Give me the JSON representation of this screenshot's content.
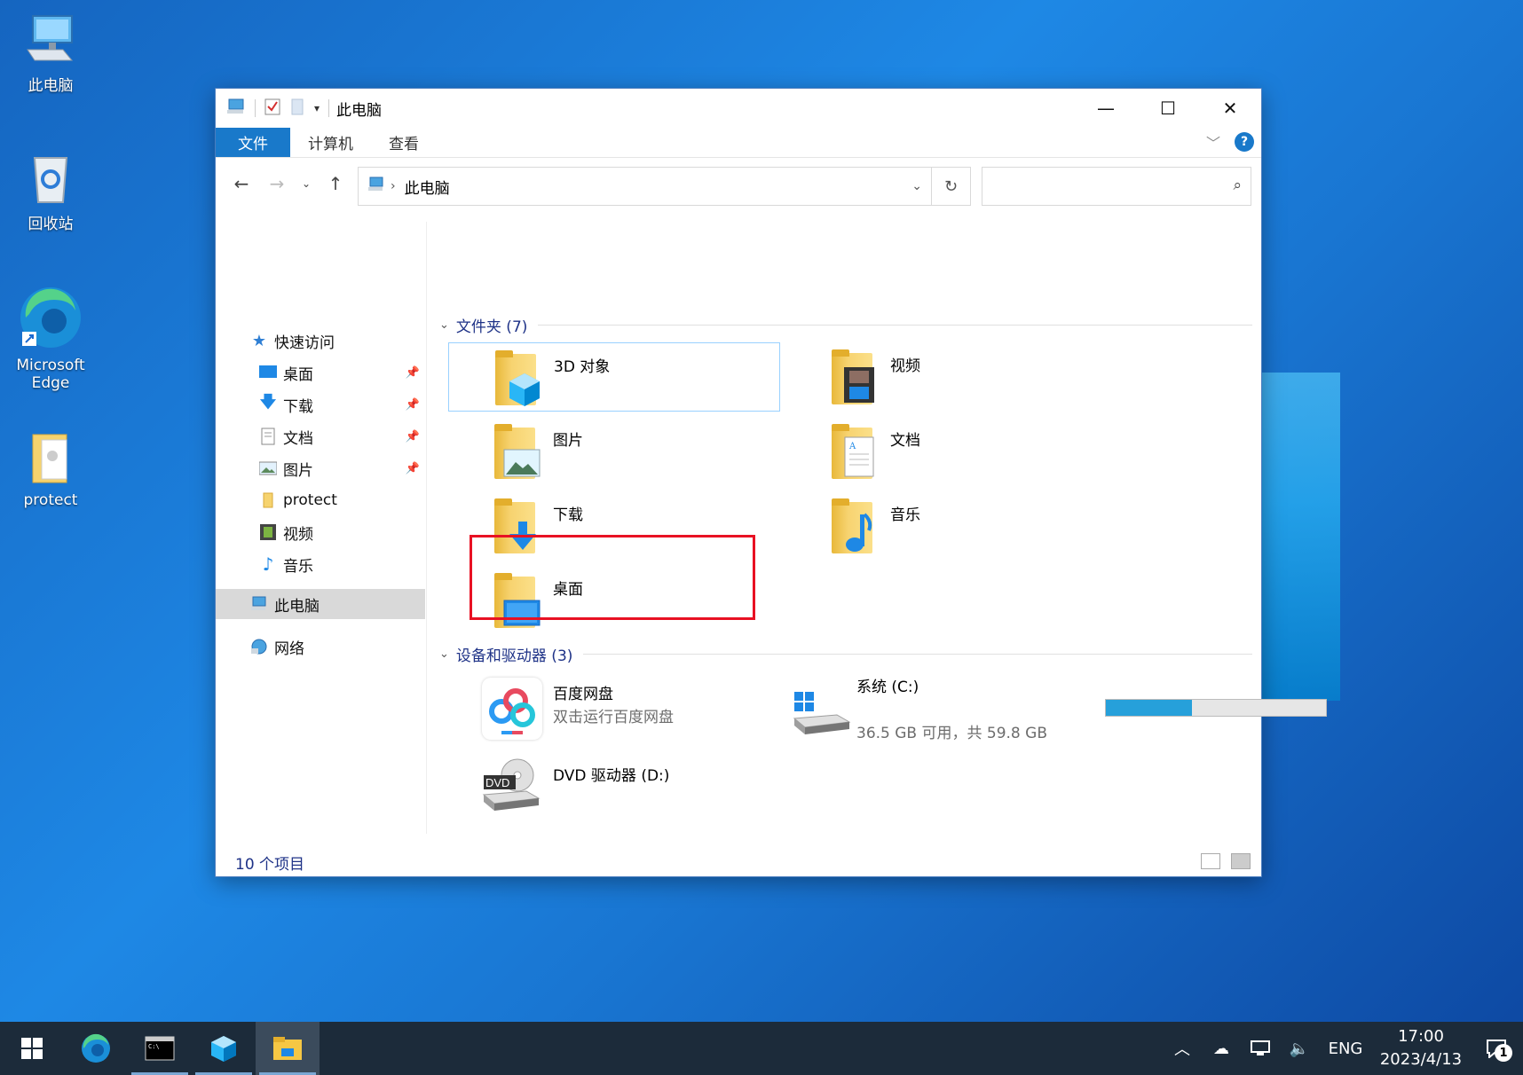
{
  "desktop": {
    "icons": [
      {
        "label": "此电脑"
      },
      {
        "label": "回收站"
      },
      {
        "label": "Microsoft Edge"
      },
      {
        "label": "protect"
      }
    ]
  },
  "window": {
    "title": "此电脑",
    "ribbon_tabs": [
      "文件",
      "计算机",
      "查看"
    ],
    "address_path": "此电脑",
    "search_placeholder": "",
    "sidebar": {
      "quick_access": "快速访问",
      "items": [
        {
          "label": "桌面",
          "pinned": true
        },
        {
          "label": "下载",
          "pinned": true
        },
        {
          "label": "文档",
          "pinned": true
        },
        {
          "label": "图片",
          "pinned": true
        },
        {
          "label": "protect",
          "pinned": false
        },
        {
          "label": "视频",
          "pinned": false
        },
        {
          "label": "音乐",
          "pinned": false
        }
      ],
      "this_pc": "此电脑",
      "network": "网络"
    },
    "folders_group": "文件夹 (7)",
    "folders": [
      {
        "label": "3D 对象"
      },
      {
        "label": "视频"
      },
      {
        "label": "图片"
      },
      {
        "label": "文档"
      },
      {
        "label": "下载"
      },
      {
        "label": "音乐"
      },
      {
        "label": "桌面"
      }
    ],
    "devices_group": "设备和驱动器 (3)",
    "devices": {
      "baidu": {
        "label": "百度网盘",
        "sub": "双击运行百度网盘"
      },
      "system": {
        "label": "系统 (C:)",
        "free_text": "36.5 GB 可用，共 59.8 GB",
        "used_fraction": 0.39
      },
      "dvd": {
        "label": "DVD 驱动器 (D:)",
        "badge": "DVD"
      }
    },
    "status": "10 个项目"
  },
  "taskbar": {
    "lang": "ENG",
    "time": "17:00",
    "date": "2023/4/13",
    "notifications": "1"
  },
  "colors": {
    "accent": "#1979ca",
    "highlight_box": "#e81123",
    "drive_fill": "#26a0da"
  }
}
